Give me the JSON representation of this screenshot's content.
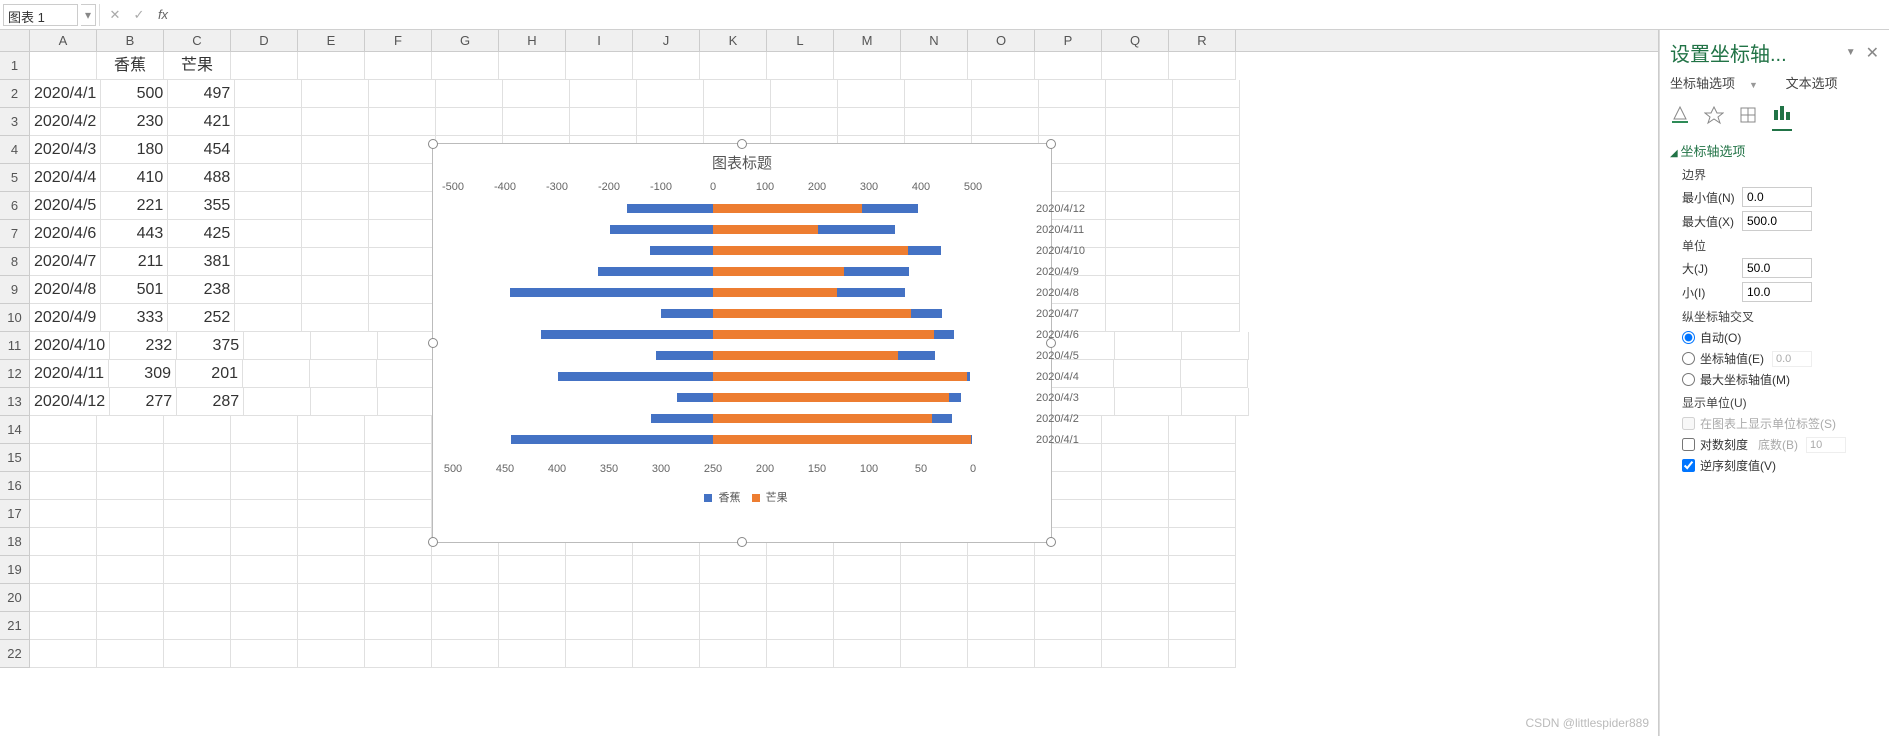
{
  "name_box": "图表 1",
  "columns": [
    "A",
    "B",
    "C",
    "D",
    "E",
    "F",
    "G",
    "H",
    "I",
    "J",
    "K",
    "L",
    "M",
    "N",
    "O",
    "P",
    "Q",
    "R"
  ],
  "row_count": 22,
  "table": {
    "header_b": "香蕉",
    "header_c": "芒果",
    "rows": [
      {
        "date": "2020/4/1",
        "b": 500,
        "c": 497
      },
      {
        "date": "2020/4/2",
        "b": 230,
        "c": 421
      },
      {
        "date": "2020/4/3",
        "b": 180,
        "c": 454
      },
      {
        "date": "2020/4/4",
        "b": 410,
        "c": 488
      },
      {
        "date": "2020/4/5",
        "b": 221,
        "c": 355
      },
      {
        "date": "2020/4/6",
        "b": 443,
        "c": 425
      },
      {
        "date": "2020/4/7",
        "b": 211,
        "c": 381
      },
      {
        "date": "2020/4/8",
        "b": 501,
        "c": 238
      },
      {
        "date": "2020/4/9",
        "b": 333,
        "c": 252
      },
      {
        "date": "2020/4/10",
        "b": 232,
        "c": 375
      },
      {
        "date": "2020/4/11",
        "b": 309,
        "c": 201
      },
      {
        "date": "2020/4/12",
        "b": 277,
        "c": 287
      }
    ]
  },
  "chart_data": {
    "type": "bar",
    "title": "图表标题",
    "top_axis_ticks": [
      -500,
      -400,
      -300,
      -200,
      -100,
      0,
      100,
      200,
      300,
      400,
      500
    ],
    "bottom_axis_ticks": [
      500,
      450,
      400,
      350,
      300,
      250,
      200,
      150,
      100,
      50,
      0
    ],
    "series": [
      {
        "name": "香蕉",
        "color": "#4472C4"
      },
      {
        "name": "芒果",
        "color": "#ED7D31"
      }
    ],
    "categories": [
      "2020/4/1",
      "2020/4/2",
      "2020/4/3",
      "2020/4/4",
      "2020/4/5",
      "2020/4/6",
      "2020/4/7",
      "2020/4/8",
      "2020/4/9",
      "2020/4/10",
      "2020/4/11",
      "2020/4/12"
    ],
    "banana": [
      500,
      230,
      180,
      410,
      221,
      443,
      211,
      501,
      333,
      232,
      309,
      277
    ],
    "mango": [
      497,
      421,
      454,
      488,
      355,
      425,
      381,
      238,
      252,
      375,
      201,
      287
    ]
  },
  "pane": {
    "title": "设置坐标轴...",
    "tab_axis_options": "坐标轴选项",
    "tab_text_options": "文本选项",
    "section_axis": "坐标轴选项",
    "bounds_label": "边界",
    "min_label": "最小值(N)",
    "min_val": "0.0",
    "max_label": "最大值(X)",
    "max_val": "500.0",
    "units_label": "单位",
    "major_label": "大(J)",
    "major_val": "50.0",
    "minor_label": "小(I)",
    "minor_val": "10.0",
    "cross_label": "纵坐标轴交叉",
    "cross_auto": "自动(O)",
    "cross_value": "坐标轴值(E)",
    "cross_value_val": "0.0",
    "cross_max": "最大坐标轴值(M)",
    "display_unit": "显示单位(U)",
    "show_unit_label": "在图表上显示单位标签(S)",
    "log_scale": "对数刻度",
    "log_base_label": "底数(B)",
    "log_base_val": "10",
    "reverse": "逆序刻度值(V)"
  },
  "watermark": "CSDN @littlespider889"
}
